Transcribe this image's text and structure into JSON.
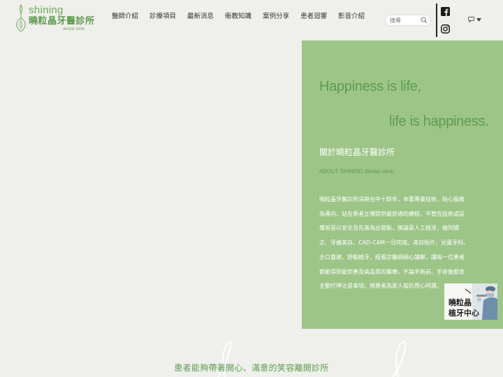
{
  "brand": {
    "name_en": "shining",
    "name_zh": "曉粒晶牙醫診所",
    "subtitle": "dental clinic"
  },
  "nav": {
    "items": [
      "醫師介紹",
      "診療項目",
      "最新消息",
      "衛教知識",
      "案例分享",
      "患者迴響",
      "影音介紹"
    ]
  },
  "search": {
    "placeholder": "搜尋"
  },
  "social": {
    "icons": [
      "facebook-icon",
      "instagram-icon"
    ]
  },
  "lang": {
    "icon": "chat-icon"
  },
  "hero": {
    "line1": "Happiness is life,",
    "line2": "life is happiness."
  },
  "about": {
    "title_zh": "關於曉粒晶牙醫診所",
    "title_en": "ABOUT SHINING dental clinic",
    "body_lines": [
      "曉粒晶牙醫診所深耕台中十餘年，本著專業技術、貼心服務",
      "為導向，站在患者立場提供最舒適的療程，不管在技術或設",
      "備皆是以安全及先進為出發點，無論是人工植牙、齒列矯",
      "正、牙齒美白、CAD-CAM一日完成、美白貼片、兒童牙科、",
      "全口重建、舒眠植牙，經看診醫師細心講解，讓每一位患者",
      "都能得到最完善及高品質的醫療，不論手術前、手術後都會",
      "主動叮嚀注意事項，視患者為家人般的用心呵護。"
    ]
  },
  "badge": {
    "line1": "曉粒晶",
    "line2": "植牙中心"
  },
  "tagline": "患者能夠帶著開心、滿意的笑容離開診所",
  "colors": {
    "panel": "#9dc587",
    "accent": "#5e9c4d",
    "background": "#efefeb"
  }
}
